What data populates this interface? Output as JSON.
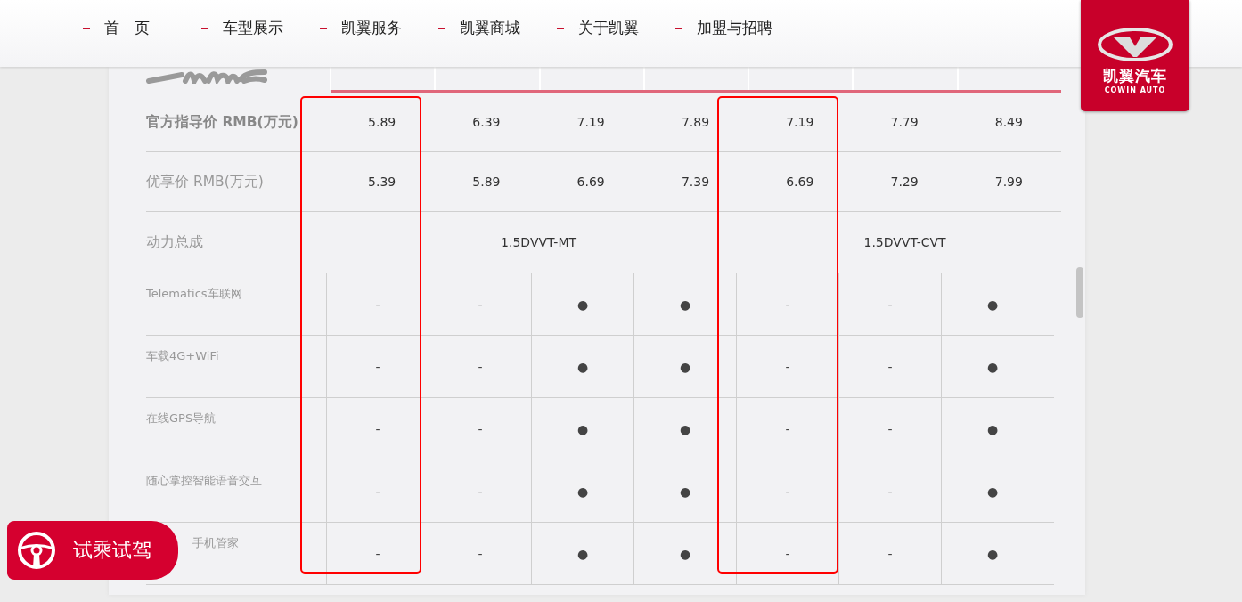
{
  "nav": [
    {
      "label": "首　页"
    },
    {
      "label": "车型展示"
    },
    {
      "label": "凯翼服务"
    },
    {
      "label": "凯翼商城"
    },
    {
      "label": "关于凯翼"
    },
    {
      "label": "加盟与招聘"
    }
  ],
  "brand": {
    "name": "凯翼汽车",
    "tagline": "COWIN AUTO"
  },
  "table": {
    "trims": [
      {
        "highlighted": true
      },
      {
        "highlighted": false
      },
      {
        "highlighted": false
      },
      {
        "highlighted": false
      },
      {
        "highlighted": true
      },
      {
        "highlighted": false
      },
      {
        "highlighted": false
      }
    ],
    "price_rows": [
      {
        "label": "官方指导价 RMB(万元)",
        "bold": true,
        "values": [
          "5.89",
          "6.39",
          "7.19",
          "7.89",
          "7.19",
          "7.79",
          "8.49"
        ]
      },
      {
        "label": "优享价 RMB(万元)",
        "bold": false,
        "values": [
          "5.39",
          "5.89",
          "6.69",
          "7.39",
          "6.69",
          "7.29",
          "7.99"
        ]
      }
    ],
    "powertrain": {
      "label": "动力总成",
      "groups": [
        {
          "text": "1.5DVVT-MT"
        },
        {
          "text": "1.5DVVT-CVT"
        }
      ]
    },
    "features": [
      {
        "label": "Telematics车联网",
        "values": [
          "-",
          "-",
          "●",
          "●",
          "-",
          "-",
          "●"
        ]
      },
      {
        "label": "车载4G+WiFi",
        "values": [
          "-",
          "-",
          "●",
          "●",
          "-",
          "-",
          "●"
        ]
      },
      {
        "label": "在线GPS导航",
        "values": [
          "-",
          "-",
          "●",
          "●",
          "-",
          "-",
          "●"
        ]
      },
      {
        "label": "随心掌控智能语音交互",
        "values": [
          "-",
          "-",
          "●",
          "●",
          "-",
          "-",
          "●"
        ]
      },
      {
        "label": "手机管家",
        "values": [
          "-",
          "-",
          "●",
          "●",
          "-",
          "-",
          "●"
        ]
      }
    ]
  },
  "test_drive": {
    "label": "试乘试驾"
  }
}
